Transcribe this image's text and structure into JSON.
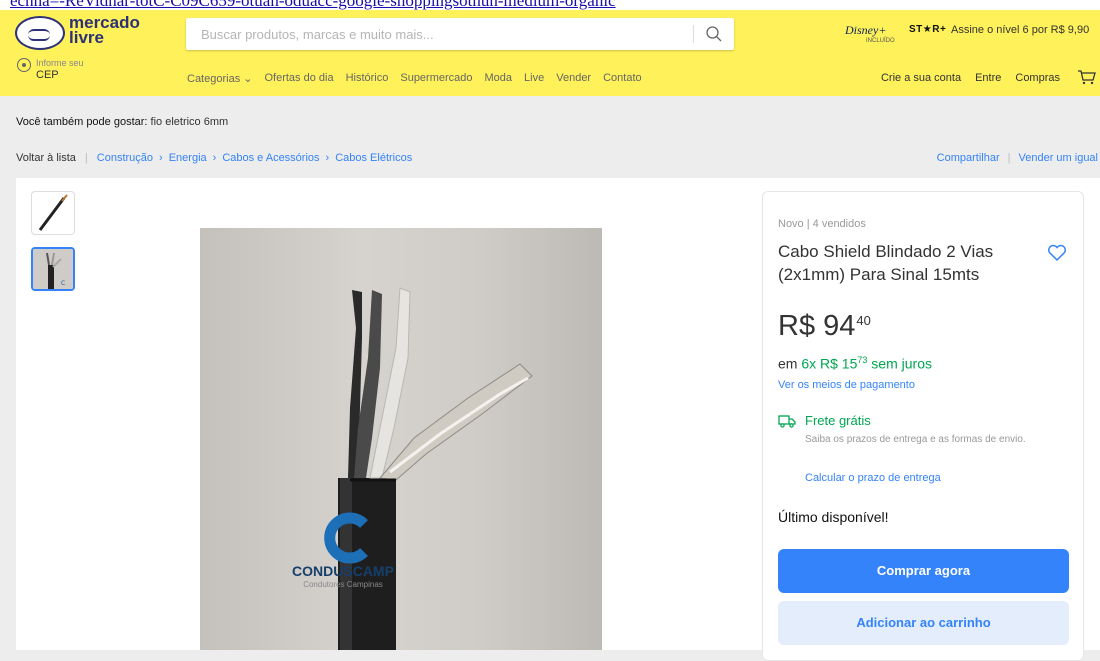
{
  "top_strip_text": "ecnna=-ReVidnar-totC-C09C659-otuan-oduacc-google-snoppingsotnun-medium-organic",
  "header": {
    "logo_line1": "mercado",
    "logo_line2": "livre",
    "search_placeholder": "Buscar produtos, marcas e muito mais...",
    "promo_brand": "Disney+",
    "promo_included": "INCLUÍDO",
    "promo_star": "ST★R+",
    "promo_text": "Assine o nível 6 por R$ 9,90",
    "cep_line1": "Informe seu",
    "cep_line2": "CEP",
    "nav": [
      "Categorias ⌄",
      "Ofertas do dia",
      "Histórico",
      "Supermercado",
      "Moda",
      "Live",
      "Vender",
      "Contato"
    ],
    "account_links": [
      "Crie a sua conta",
      "Entre",
      "Compras"
    ]
  },
  "recommendations": {
    "label": "Você também pode gostar:",
    "query": "fio eletrico 6mm"
  },
  "breadcrumb": {
    "back": "Voltar à lista",
    "items": [
      "Construção",
      "Energia",
      "Cabos e Acessórios",
      "Cabos Elétricos"
    ],
    "share": "Compartilhar",
    "sell_same": "Vender um igual"
  },
  "product": {
    "image_brand": "CONDUSCAMP",
    "image_brand_sub": "Condutores Campinas",
    "condition": "Novo  |  4 vendidos",
    "title": "Cabo Shield Blindado 2 Vias (2x1mm) Para Sinal 15mts",
    "price_currency": "R$",
    "price_int": "94",
    "price_cents": "40",
    "installments_prefix": "em ",
    "installments_green": "6x R$ 15",
    "installments_cents": "73",
    "installments_suffix": " sem juros",
    "payment_link": "Ver os meios de pagamento",
    "shipping_title": "Frete grátis",
    "shipping_desc": "Saiba os prazos de entrega e as formas de envio.",
    "shipping_calc": "Calcular o prazo de entrega",
    "stock": "Último disponível!",
    "buy_now": "Comprar agora",
    "add_cart": "Adicionar ao carrinho"
  },
  "colors": {
    "header_bg": "#fff159",
    "accent": "#3483fa",
    "green": "#00a650"
  }
}
